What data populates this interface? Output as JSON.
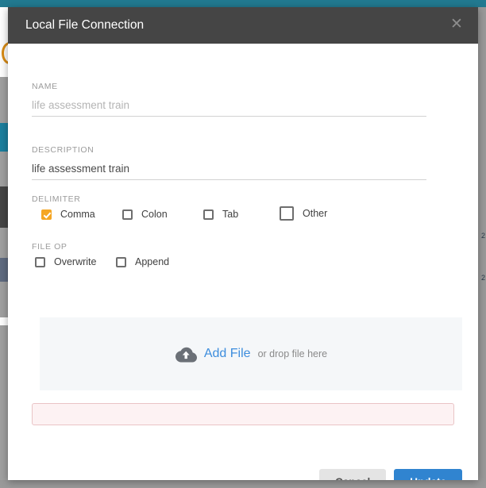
{
  "modal": {
    "title": "Local File Connection",
    "close_icon": "close-icon",
    "name": {
      "label": "NAME",
      "value": "",
      "placeholder": "life assessment train"
    },
    "description": {
      "label": "DESCRIPTION",
      "value": "life assessment train",
      "placeholder": ""
    },
    "delimiter": {
      "label": "DELIMITER",
      "options": [
        {
          "label": "Comma",
          "checked": true
        },
        {
          "label": "Colon",
          "checked": false
        },
        {
          "label": "Tab",
          "checked": false
        },
        {
          "label": "Other",
          "checked": false
        }
      ]
    },
    "file_op": {
      "label": "FILE OP",
      "options": [
        {
          "label": "Overwrite",
          "checked": false
        },
        {
          "label": "Append",
          "checked": false
        }
      ]
    },
    "dropzone": {
      "icon": "cloud-upload-icon",
      "link_label": "Add File",
      "hint": "or drop file here"
    },
    "error_field": {
      "value": "",
      "placeholder": ""
    },
    "footer": {
      "cancel_label": "Cancel",
      "update_label": "Update"
    }
  },
  "background": {
    "right_marks": [
      "2",
      "2"
    ]
  },
  "colors": {
    "header_bg": "#454545",
    "accent_checked": "#f5a623",
    "link_blue": "#3d8ddd",
    "primary_button": "#3084d0",
    "error_border": "#eac4c6",
    "error_bg": "#fdf2f3",
    "app_teal": "#227a91"
  }
}
